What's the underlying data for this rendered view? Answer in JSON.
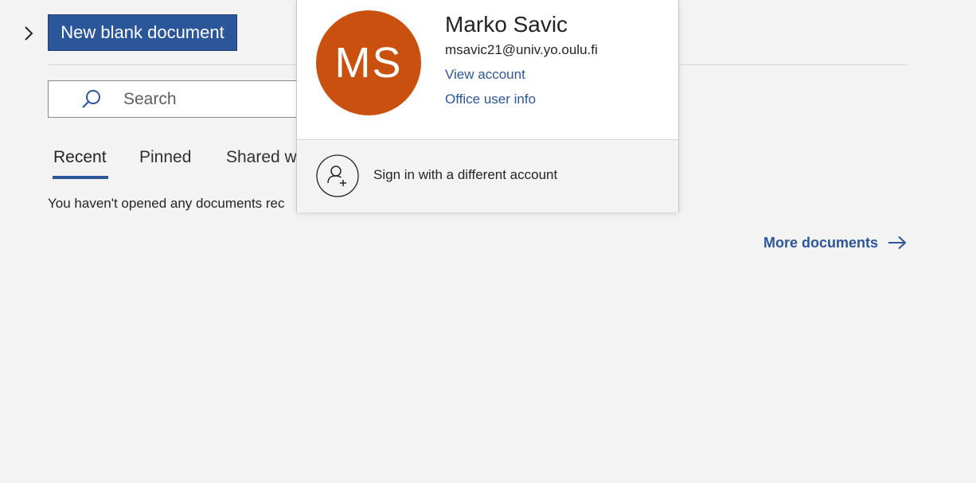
{
  "header": {
    "new_blank_label": "New blank document"
  },
  "search": {
    "placeholder": "Search"
  },
  "tabs": [
    {
      "label": "Recent",
      "active": true
    },
    {
      "label": "Pinned",
      "active": false
    },
    {
      "label": "Shared w",
      "active": false
    }
  ],
  "documents": {
    "empty_message": "You haven't opened any documents rec",
    "more_link": "More documents"
  },
  "account": {
    "initials": "MS",
    "avatar_color": "#ca5010",
    "name": "Marko Savic",
    "email": "msavic21@univ.yo.oulu.fi",
    "view_account": "View account",
    "office_user_info": "Office user info",
    "sign_in_different": "Sign in with a different account"
  },
  "colors": {
    "accent": "#2b579a",
    "background": "#f3f3f3"
  },
  "icons": {
    "expand": "chevron-right-icon",
    "search": "search-icon",
    "more": "arrow-right-icon",
    "add_account": "add-person-icon"
  }
}
